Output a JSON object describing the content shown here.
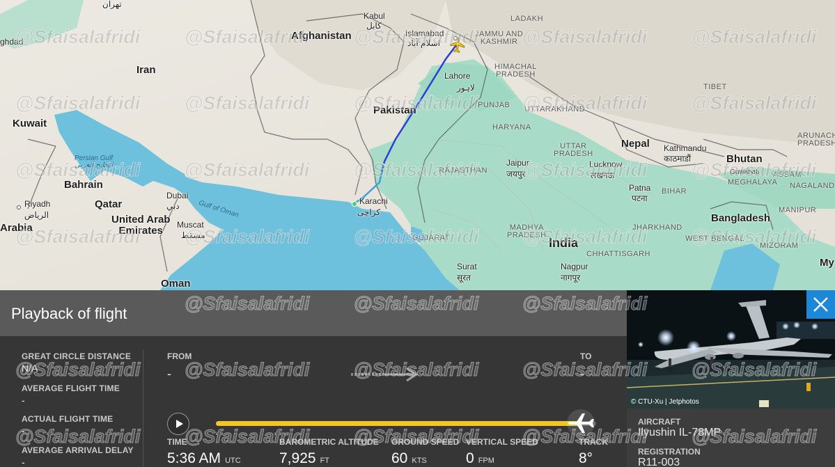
{
  "map": {
    "countries": {
      "afghanistan": "Afghanistan",
      "iran": "Iran",
      "pakistan": "Pakistan",
      "india": "India",
      "nepal": "Nepal",
      "bhutan": "Bhutan",
      "bangladesh": "Bangladesh",
      "kuwait": "Kuwait",
      "bahrain": "Bahrain",
      "qatar": "Qatar",
      "uae": "United Arab\nEmirates",
      "oman": "Oman",
      "arabia": "Arabia",
      "my": "My"
    },
    "cities": {
      "tehran": "تهران",
      "baghdad": "ghdad",
      "kabul": "Kabul",
      "kabul_native": "کابل",
      "islamabad": "Islamabad",
      "islamabad_native": "اسلام آباد",
      "lahore": "Lahore",
      "lahore_native": "لاہور",
      "karachi": "Karachi",
      "karachi_native": "کراچی",
      "riyadh": "Riyadh",
      "riyadh_native": "الرياض",
      "dubai": "Dubai",
      "dubai_native": "دبي",
      "muscat": "Muscat",
      "muscat_native": "مسقط",
      "jaipur": "Jaipur",
      "jaipur_native": "जयपुर",
      "lucknow": "Lucknow",
      "lucknow_native": "लखनऊ",
      "kathmandu": "Kathmandu",
      "kathmandu_native": "काठमाडौं",
      "patna": "Patna",
      "patna_native": "पटना",
      "guwahati": "Guwahati",
      "surat": "Surat",
      "surat_native": "सूरत",
      "nagpur": "Nagpur",
      "nagpur_native": "नागपूर"
    },
    "regions": {
      "ladakh": "LADAKH",
      "jk": "JAMMU AND\nKASHMIR",
      "himachal": "HIMACHAL\nPRADESH",
      "punjab": "PUNJAB",
      "uttarakhand": "UTTARAKHAND",
      "haryana": "HARYANA",
      "up": "UTTAR\nPRADESH",
      "rajasthan": "RAJASTHAN",
      "bihar": "BIHAR",
      "jharkhand": "JHARKHAND",
      "mp": "MADHYA\nPRADESH",
      "chhattisgarh": "CHHATTISGARH",
      "gujarat": "GUJARAT",
      "west_bengal": "WEST BENGAL",
      "tibet": "TIBET",
      "arunachal": "ARUNACHA\nPRADESH",
      "assam": "ASSAM",
      "meghalaya": "MEGHALAYA",
      "nagaland": "NAGALAND",
      "manipur": "MANIPUR",
      "mizoram": "MIZORAM"
    },
    "seas": {
      "persian_gulf": "Persian Gulf\nالخليج العربي",
      "gulf_of_oman": "Gulf of Oman"
    }
  },
  "watermark": "@Sfaisalafridi",
  "panel": {
    "title": "Playback of flight",
    "great_circle_label": "GREAT CIRCLE DISTANCE",
    "great_circle_value": "N/A",
    "avg_flight_time_label": "AVERAGE FLIGHT TIME",
    "avg_flight_time_value": "-",
    "actual_flight_time_label": "ACTUAL FLIGHT TIME",
    "actual_flight_time_value": "-",
    "avg_arrival_delay_label": "AVERAGE ARRIVAL DELAY",
    "avg_arrival_delay_value": "-",
    "from_label": "FROM",
    "from_value": "-",
    "to_label": "TO",
    "to_value": "-",
    "playback_progress": 0.96,
    "telemetry": {
      "time_label": "TIME",
      "time_value": "5:36 AM",
      "time_unit": "UTC",
      "altitude_label": "BAROMETRIC ALTITUDE",
      "altitude_value": "7,925",
      "altitude_unit": "FT",
      "ground_speed_label": "GROUND SPEED",
      "ground_speed_value": "60",
      "ground_speed_unit": "KTS",
      "vertical_speed_label": "VERTICAL SPEED",
      "vertical_speed_value": "0",
      "vertical_speed_unit": "FPM",
      "track_label": "TRACK",
      "track_value": "8°"
    }
  },
  "aircraft": {
    "photo_credit": "© CTU-Xu | Jetphotos",
    "aircraft_label": "AIRCRAFT",
    "aircraft_value": "Ilyushin IL-78MP",
    "registration_label": "REGISTRATION",
    "registration_value": "R11-003"
  },
  "colors": {
    "accent_yellow": "#f3c623",
    "close_blue": "#1e88d8",
    "track_blue": "#2b3fd6",
    "water": "#6ec1dd"
  },
  "icons": {
    "play": "play-icon",
    "plane": "airplane-icon",
    "close": "close-icon",
    "route_arrow": "arrow-right-icon"
  }
}
